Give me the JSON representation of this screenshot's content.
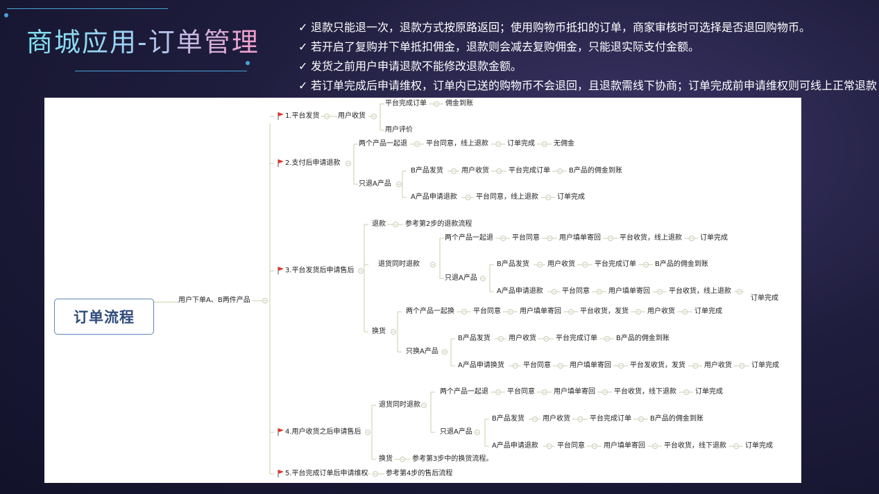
{
  "slide": {
    "title": "商城应用-订单管理",
    "notes": [
      "退款只能退一次，退款方式按原路返回；使用购物币抵扣的订单，商家审核时可选择是否退回购物币。",
      "若开启了复购并下单抵扣佣金，退款则会减去复购佣金，只能退实际支付金额。",
      "发货之前用户申请退款不能修改退款金额。",
      "若订单完成后申请维权，订单内已送的购物币不会退回，且退款需线下协商；订单完成前申请维权则可线上正常退款"
    ]
  },
  "mindmap": {
    "root": "订单流程",
    "level1": "用户下单A、B两件产品",
    "branches": {
      "b1": {
        "label": "1.平台发货",
        "user_receive": "用户收货",
        "row1": [
          "平台完成订单",
          "佣金到账"
        ],
        "row2": [
          "用户评价"
        ]
      },
      "b2": {
        "label": "2.支付后申请退款",
        "both": [
          "两个产品一起退",
          "平台同意，线上退款",
          "订单完成",
          "无佣金"
        ],
        "onlyA": "只退A产品",
        "onlyA_b": [
          "B产品发货",
          "用户收货",
          "平台完成订单",
          "B产品的佣金到账"
        ],
        "onlyA_a": [
          "A产品申请退款",
          "平台同意，线上退款",
          "订单完成"
        ]
      },
      "b3": {
        "label": "3.平台发货后申请售后",
        "refund": [
          "退款",
          "参考第2步的退款流程"
        ],
        "return_refund": "退货同时退款",
        "rr_both": [
          "两个产品一起退",
          "平台同意",
          "用户填单寄回",
          "平台收货，线上退款",
          "订单完成"
        ],
        "rr_onlyA": "只退A产品",
        "rr_onlyA_b": [
          "B产品发货",
          "用户收货",
          "平台完成订单",
          "B产品的佣金到账"
        ],
        "rr_onlyA_a": [
          "A产品申请退款",
          "平台同意",
          "用户填单寄回",
          "平台收货，线上退款",
          "订单完成"
        ],
        "exchange": "换货",
        "ex_both": [
          "两个产品一起换",
          "平台同意",
          "用户填单寄回",
          "平台收货，发货",
          "用户收货",
          "订单完成"
        ],
        "ex_onlyA": "只换A产品",
        "ex_onlyA_b": [
          "B产品发货",
          "用户收货",
          "平台完成订单",
          "B产品的佣金到账"
        ],
        "ex_onlyA_a": [
          "A产品申请换货",
          "平台同意",
          "用户填单寄回",
          "平台发收货，发货",
          "用户收货",
          "订单完成"
        ]
      },
      "b4": {
        "label": "4.用户收货之后申请售后",
        "return_refund": "退货同时退款",
        "rr_both": [
          "两个产品一起退",
          "平台同意",
          "用户填单寄回",
          "平台收货，线下退款",
          "订单完成"
        ],
        "rr_onlyA": "只退A产品",
        "rr_onlyA_b": [
          "B产品发货",
          "用户收货",
          "平台完成订单",
          "B产品的佣金到账"
        ],
        "rr_onlyA_a": [
          "A产品申请退款",
          "平台同意",
          "用户填单寄回",
          "平台收货，线下退款",
          "订单完成"
        ],
        "exchange": [
          "换货",
          "参考第3步中的换货流程。"
        ]
      },
      "b5": {
        "label": "5.平台完成订单后申请维权",
        "ref": "参考第4步的售后流程"
      }
    }
  }
}
